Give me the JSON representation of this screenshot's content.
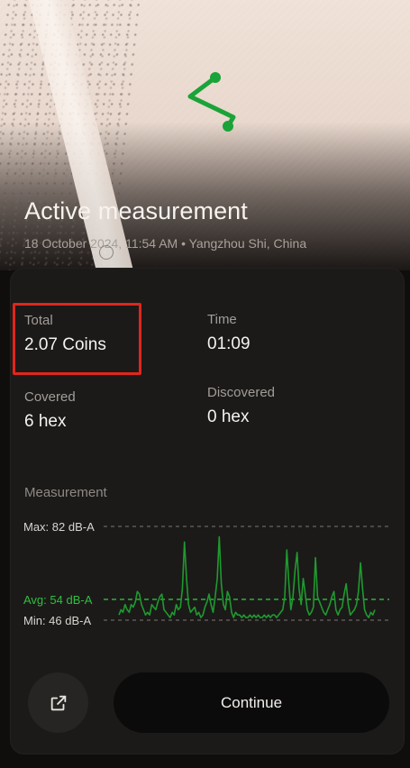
{
  "header": {
    "title": "Active measurement",
    "subtitle": "18 October 2024, 11:54 AM • Yangzhou Shi, China",
    "route_color": "#1aa338"
  },
  "stats": {
    "total": {
      "label": "Total",
      "value": "2.07 Coins"
    },
    "time": {
      "label": "Time",
      "value": "01:09"
    },
    "covered": {
      "label": "Covered",
      "value": "6 hex"
    },
    "discovered": {
      "label": "Discovered",
      "value": "0 hex"
    }
  },
  "measurement": {
    "label": "Measurement",
    "max_label": "Max: 82 dB-A",
    "avg_label": "Avg: 54 dB-A",
    "min_label": "Min: 46 dB-A"
  },
  "chart_data": {
    "type": "line",
    "title": "Measurement",
    "unit": "dB-A",
    "max": 82,
    "avg": 54,
    "min": 46,
    "ylim": [
      46,
      82
    ],
    "line_color": "#1f9a2e",
    "avg_color": "#2fbf3f",
    "values": [
      48,
      50,
      49,
      52,
      50,
      49,
      52,
      51,
      53,
      57,
      56,
      52,
      50,
      48,
      49,
      48,
      52,
      51,
      50,
      53,
      55,
      56,
      50,
      49,
      48,
      47,
      49,
      48,
      52,
      50,
      51,
      58,
      76,
      62,
      52,
      49,
      50,
      51,
      48,
      49,
      47,
      48,
      51,
      53,
      56,
      52,
      49,
      55,
      62,
      78,
      60,
      52,
      50,
      57,
      55,
      49,
      47,
      49,
      48,
      48,
      47,
      48,
      47,
      47,
      48,
      47,
      48,
      47,
      48,
      47,
      47,
      48,
      47,
      48,
      47,
      48,
      48,
      47,
      48,
      49,
      50,
      55,
      73,
      60,
      50,
      55,
      65,
      72,
      58,
      52,
      62,
      56,
      50,
      48,
      49,
      51,
      70,
      55,
      53,
      51,
      49,
      48,
      50,
      52,
      55,
      57,
      50,
      48,
      50,
      51,
      56,
      60,
      52,
      48,
      49,
      50,
      52,
      57,
      68,
      58,
      50,
      48,
      47,
      49,
      48,
      50
    ]
  },
  "actions": {
    "share_icon": "external-link-icon",
    "continue_label": "Continue"
  }
}
